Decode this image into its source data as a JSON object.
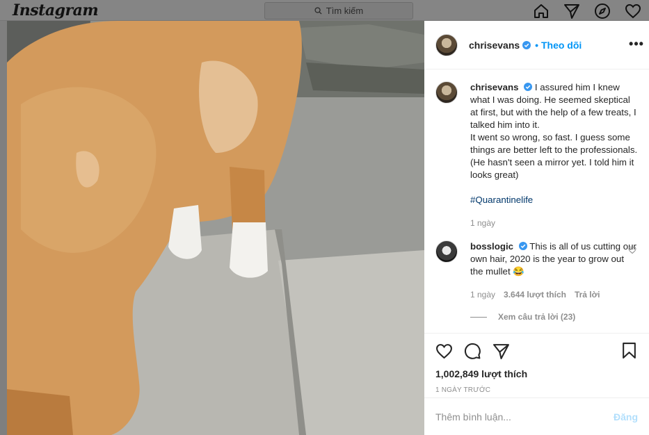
{
  "nav": {
    "logo": "Instagram",
    "search_placeholder": "Tìm kiếm",
    "icons": [
      "home-icon",
      "direct-icon",
      "explore-icon",
      "activity-heart-icon"
    ]
  },
  "post": {
    "username": "chrisevans",
    "follow_label": "Theo dõi",
    "more_label": "•••",
    "caption_lines": [
      "I assured him I knew what I was doing. He seemed skeptical at first, but with the help of a few treats, I talked him into it.",
      "It went so wrong, so fast. I guess some things are better left to the professionals. (He hasn't seen a mirror yet. I told him it looks great)"
    ],
    "hashtag": "#Quarantinelife",
    "caption_age": "1 ngày",
    "likes": "1,002,849 lượt thích",
    "date": "1 NGÀY TRƯỚC"
  },
  "comment": {
    "username": "bosslogic",
    "text": "This is all of us cutting our own hair, 2020 is the year to grow out the mullet 😂",
    "age": "1 ngày",
    "likes": "3.644 lượt thích",
    "reply": "Trả lời",
    "view_replies": "Xem câu trả lời (23)"
  },
  "composer": {
    "placeholder": "Thêm bình luận...",
    "post_label": "Đăng"
  },
  "colors": {
    "accent": "#0095f6",
    "verified": "#3897f0",
    "link": "#00376b"
  }
}
